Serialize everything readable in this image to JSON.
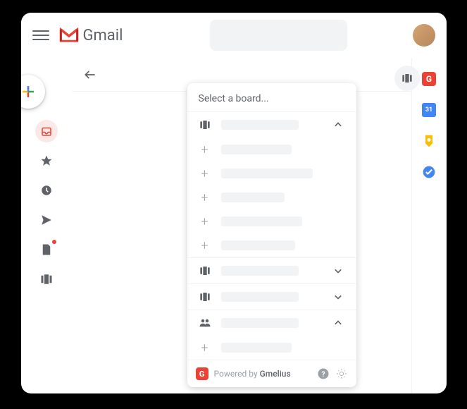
{
  "header": {
    "app_name": "Gmail"
  },
  "dropdown": {
    "title": "Select a board...",
    "footer_prefix": "Powered by ",
    "footer_brand": "Gmelius",
    "badge_letter": "G"
  },
  "right_sidebar": {
    "calendar_day": "31"
  },
  "icons": {
    "hamburger": "menu-icon",
    "compose": "plus-icon",
    "back": "back-arrow-icon",
    "board": "board-icon",
    "inbox": "inbox-icon",
    "star": "star-icon",
    "clock": "clock-icon",
    "sent": "sent-icon",
    "drafts": "drafts-icon",
    "boards_nav": "boards-nav-icon",
    "gmelius": "gmelius-icon",
    "calendar": "calendar-icon",
    "keep": "keep-icon",
    "tasks": "tasks-icon",
    "help": "help-icon",
    "settings": "settings-icon",
    "chevron_up": "chevron-up-icon",
    "chevron_down": "chevron-down-icon",
    "people": "people-icon"
  }
}
